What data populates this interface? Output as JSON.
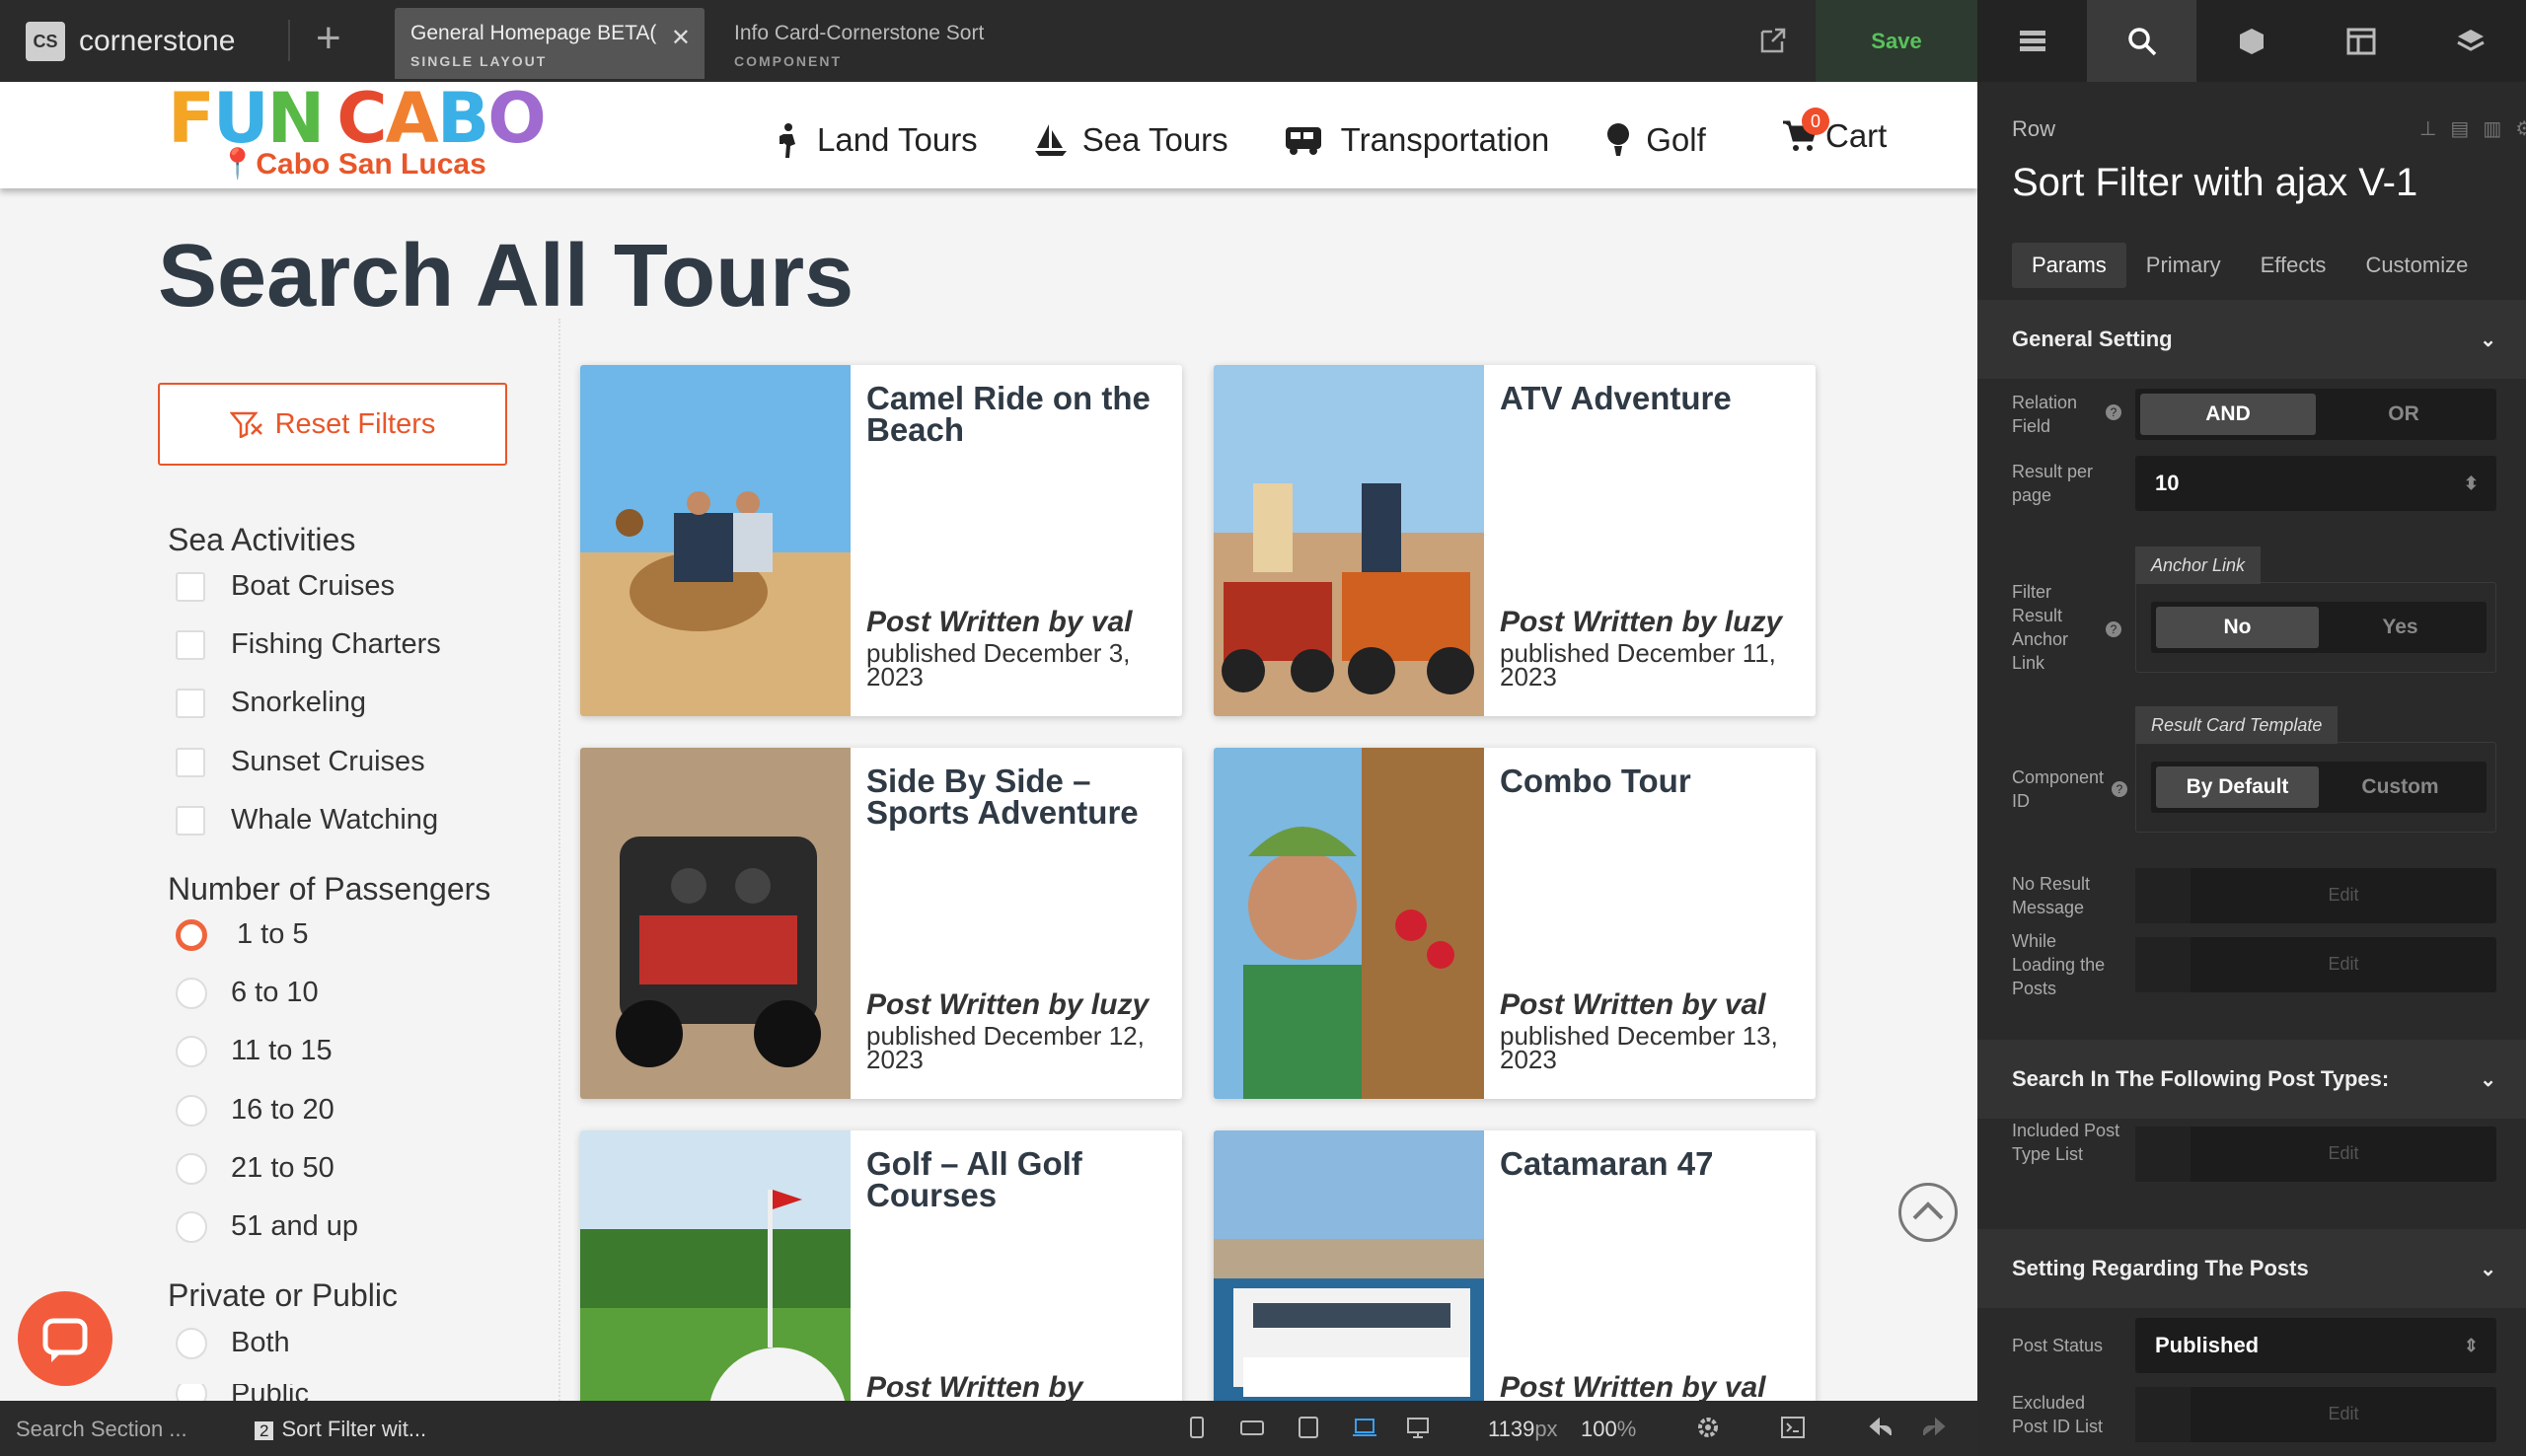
{
  "app": {
    "logo_badge": "CS",
    "logo_text": "cornerstone",
    "save": "Save"
  },
  "tabs": [
    {
      "title": "General Homepage BETA(",
      "sub": "SINGLE LAYOUT"
    },
    {
      "title": "Info Card-Cornerstone Sort",
      "sub": "COMPONENT"
    }
  ],
  "site": {
    "brand": [
      "F",
      "U",
      "N",
      "C",
      "A",
      "B",
      "O"
    ],
    "location": "Cabo San Lucas",
    "nav": [
      "Land Tours",
      "Sea Tours",
      "Transportation",
      "Golf"
    ],
    "cart": "Cart",
    "cart_count": "0"
  },
  "page": {
    "title": "Search All Tours",
    "reset": "Reset Filters"
  },
  "filters": {
    "sea_head": "Sea Activities",
    "sea": [
      "Boat Cruises",
      "Fishing Charters",
      "Snorkeling",
      "Sunset Cruises",
      "Whale Watching"
    ],
    "pass_head": "Number of Passengers",
    "pass": [
      "1 to 5",
      "6 to 10",
      "11 to 15",
      "16 to 20",
      "21 to 50",
      "51 and up"
    ],
    "priv_head": "Private or Public",
    "priv": [
      "Both",
      "Public"
    ]
  },
  "cards": [
    {
      "title": "Camel Ride on the Beach",
      "by": "Post Written by val",
      "pub": "published December 3, 2023"
    },
    {
      "title": "ATV Adventure",
      "by": "Post Written by luzy",
      "pub": "published December 11, 2023"
    },
    {
      "title": "Side By Side – Sports Adventure",
      "by": "Post Written by luzy",
      "pub": "published December 12, 2023"
    },
    {
      "title": "Combo Tour",
      "by": "Post Written by val",
      "pub": "published December 13, 2023"
    },
    {
      "title": "Golf – All Golf Courses",
      "by": "Post Written by thefungroup",
      "pub": ""
    },
    {
      "title": "Catamaran 47",
      "by": "Post Written by val",
      "pub": ""
    }
  ],
  "bottom": {
    "search": "Search Section ...",
    "breadcrumb": "Sort Filter wit...",
    "bc_num": "2",
    "width": "1139",
    "width_unit": "px",
    "zoom": "100",
    "zoom_unit": "%"
  },
  "panel": {
    "kind": "Row",
    "name": "Sort Filter with ajax V-1",
    "tabs": [
      "Params",
      "Primary",
      "Effects",
      "Customize"
    ],
    "general": "General Setting",
    "relation_label": "Relation Field",
    "relation": [
      "AND",
      "OR"
    ],
    "rpp_label": "Result per page",
    "rpp": "10",
    "anchor_tag": "Anchor Link",
    "anchor_label": "Filter Result Anchor Link",
    "anchor": [
      "No",
      "Yes"
    ],
    "rct_tag": "Result Card Template",
    "comp_label": "Component ID",
    "comp": [
      "By Default",
      "Custom"
    ],
    "nores_label": "No Result Message",
    "loading_label": "While Loading the Posts",
    "edit": "Edit",
    "search_sec": "Search In The Following Post Types:",
    "incl_label": "Included Post Type List",
    "posts_sec": "Setting Regarding The Posts",
    "status_label": "Post Status",
    "status": "Published",
    "excl_label": "Excluded Post ID List"
  }
}
